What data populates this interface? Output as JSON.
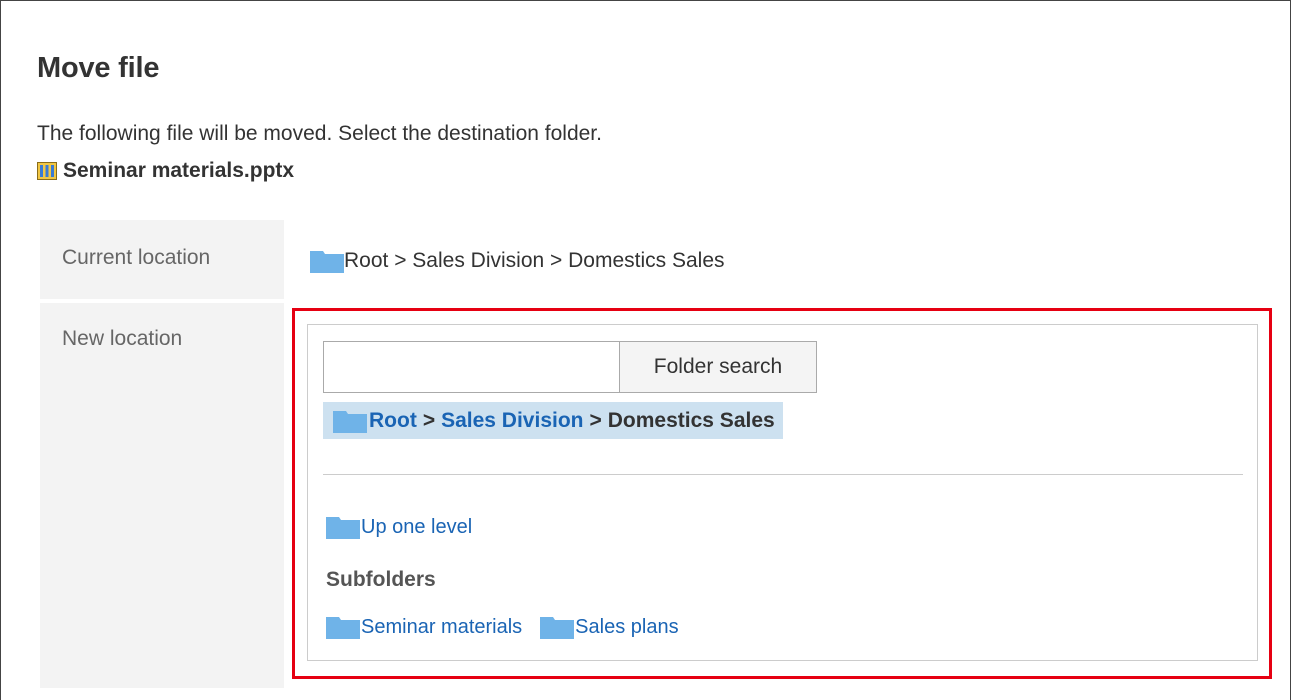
{
  "dialog": {
    "title": "Move file",
    "description": "The following file will be moved. Select the destination folder.",
    "file_name": "Seminar materials.pptx",
    "file_icon": "presentation-file-icon"
  },
  "current_location": {
    "label": "Current location",
    "path": "Root > Sales Division > Domestics Sales",
    "icon": "folder-icon"
  },
  "new_location": {
    "label": "New location",
    "search": {
      "value": "",
      "placeholder": "",
      "button_label": "Folder search"
    },
    "breadcrumb": {
      "items": [
        {
          "label": "Root",
          "link": true
        },
        {
          "label": "Sales Division",
          "link": true
        },
        {
          "label": "Domestics Sales",
          "link": false
        }
      ],
      "separator": ">"
    },
    "up_one_level_label": "Up one level",
    "subfolders_heading": "Subfolders",
    "subfolders": [
      {
        "label": "Seminar materials"
      },
      {
        "label": "Sales plans"
      }
    ]
  },
  "colors": {
    "highlight_border": "#e60012",
    "link": "#1a64b4",
    "breadcrumb_bg": "#cde1f0",
    "label_bg": "#f3f3f3",
    "folder": "#6fb3e8"
  }
}
